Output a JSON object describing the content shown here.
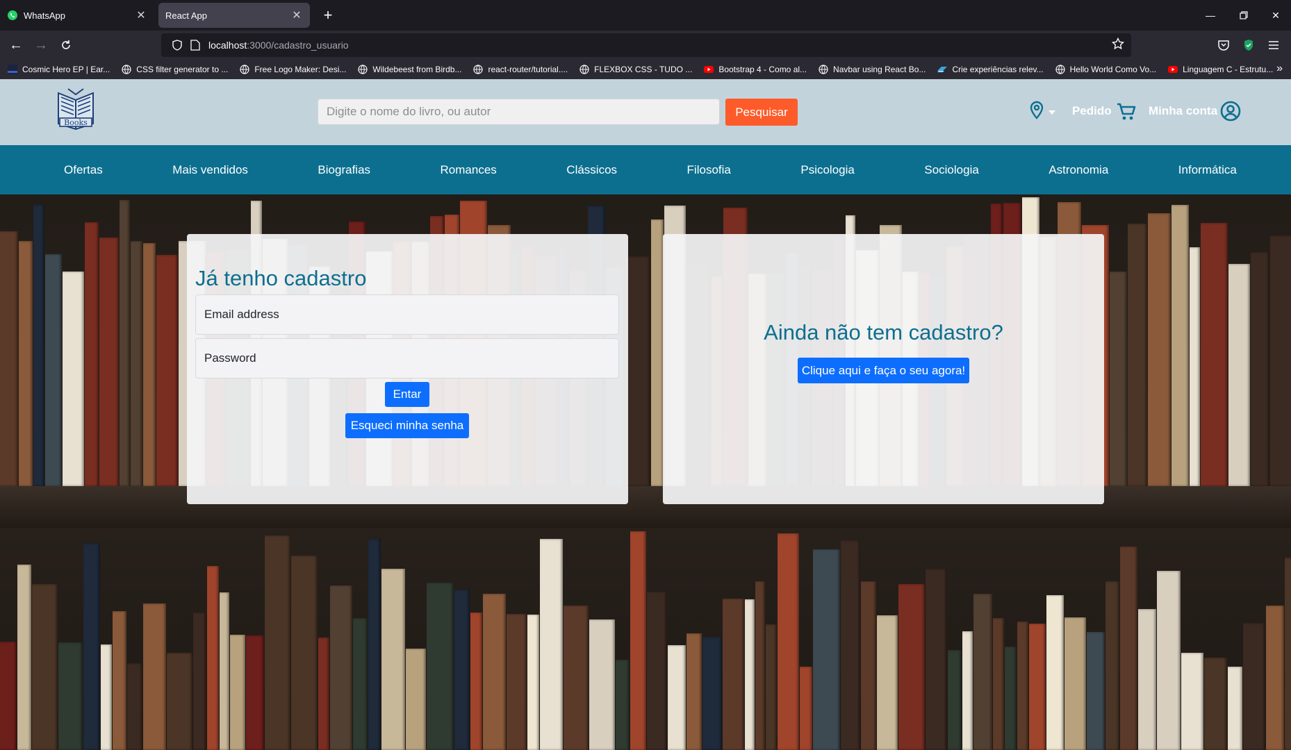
{
  "browser": {
    "tabs": [
      {
        "title": "WhatsApp",
        "icon": "whatsapp-icon",
        "active": false
      },
      {
        "title": "React App",
        "icon": "none",
        "active": true
      }
    ],
    "new_tab_label": "+",
    "url_host": "localhost",
    "url_path": ":3000/cadastro_usuario",
    "bookmarks": [
      {
        "label": "Cosmic Hero EP | Ear...",
        "icon": "bandcamp-icon"
      },
      {
        "label": "CSS filter generator to ...",
        "icon": "globe-icon"
      },
      {
        "label": "Free Logo Maker: Desi...",
        "icon": "globe-icon"
      },
      {
        "label": "Wildebeest from Birdb...",
        "icon": "globe-icon"
      },
      {
        "label": "react-router/tutorial....",
        "icon": "globe-icon"
      },
      {
        "label": "FLEXBOX CSS - TUDO ...",
        "icon": "globe-icon"
      },
      {
        "label": "Bootstrap 4 - Como al...",
        "icon": "youtube-icon"
      },
      {
        "label": "Navbar using React Bo...",
        "icon": "globe-icon"
      },
      {
        "label": "Crie experiências relev...",
        "icon": "brand-icon"
      },
      {
        "label": "Hello World Como Vo...",
        "icon": "globe-icon"
      },
      {
        "label": "Linguagem C - Estrutu...",
        "icon": "youtube-icon"
      }
    ]
  },
  "header": {
    "logo_text": "Books",
    "search_placeholder": "Digite o nome do livro, ou autor",
    "search_button": "Pesquisar",
    "order_label": "Pedido",
    "account_label": "Minha conta"
  },
  "categories": [
    "Ofertas",
    "Mais vendidos",
    "Biografias",
    "Romances",
    "Clássicos",
    "Filosofia",
    "Psicologia",
    "Sociologia",
    "Astronomia",
    "Informática"
  ],
  "login": {
    "title": "Já tenho cadastro",
    "email_placeholder": "Email address",
    "password_placeholder": "Password",
    "submit_label": "Entar",
    "forgot_label": "Esqueci minha senha"
  },
  "register": {
    "title": "Ainda não tem cadastro?",
    "button_label": "Clique aqui e faça o seu agora!"
  },
  "colors": {
    "header_bg": "#c3d3dc",
    "category_bar": "#0d6f8f",
    "search_button": "#fd5b2a",
    "primary_button": "#0d6efd",
    "title_text": "#0d6f8f"
  }
}
